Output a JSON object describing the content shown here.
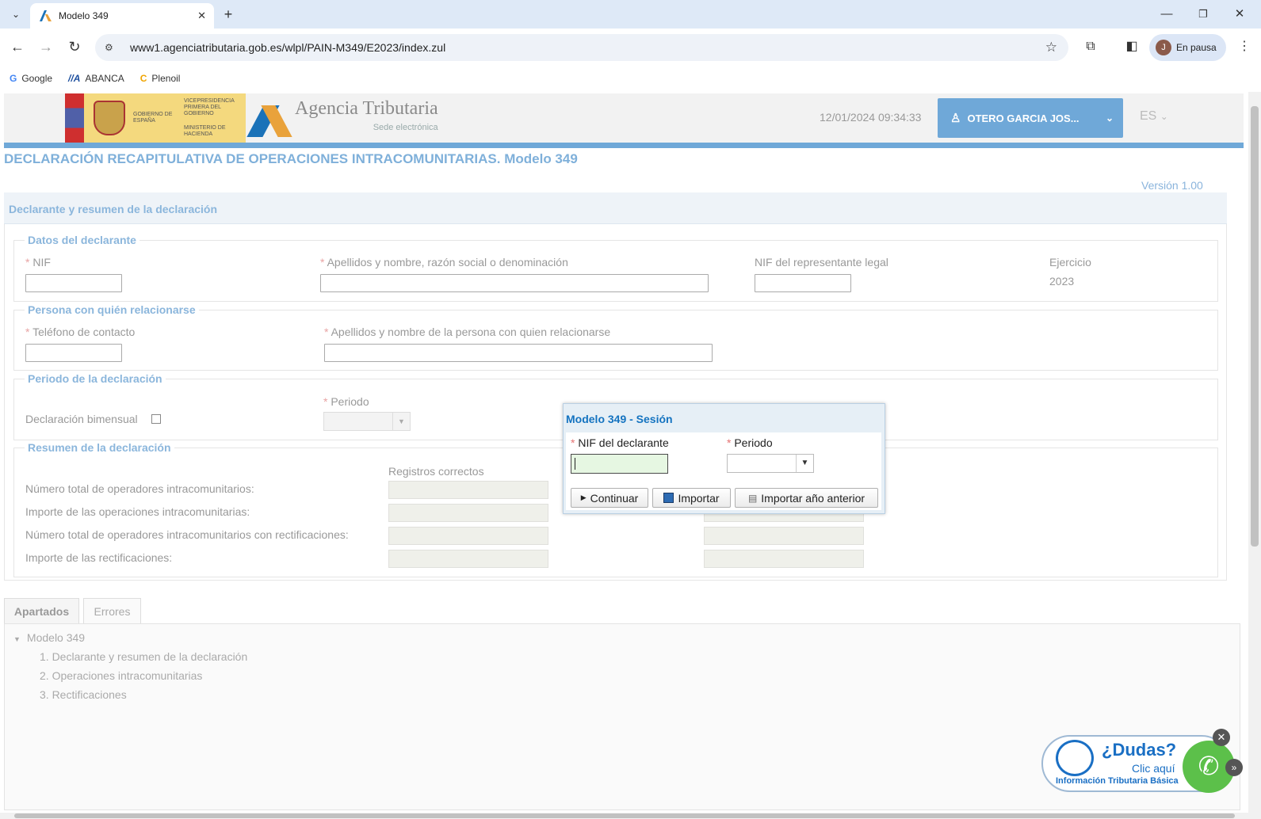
{
  "browser": {
    "tab_title": "Modelo 349",
    "new_tab": "+",
    "url": "www1.agenciatributaria.gob.es/wlpl/PAIN-M349/E2023/index.zul",
    "profile_initial": "J",
    "profile_label": "En pausa",
    "bookmarks": [
      {
        "label": "Google",
        "icon": "G"
      },
      {
        "label": "ABANCA",
        "icon": "//A"
      },
      {
        "label": "Plenoil",
        "icon": "C"
      }
    ]
  },
  "header": {
    "gov_line1": "GOBIERNO DE ESPAÑA",
    "gov_line2": "VICEPRESIDENCIA PRIMERA DEL GOBIERNO",
    "gov_line3": "MINISTERIO DE HACIENDA",
    "agency_name": "Agencia Tributaria",
    "agency_sub": "Sede electrónica",
    "datetime": "12/01/2024 09:34:33",
    "user": "OTERO GARCIA JOS...",
    "lang": "ES"
  },
  "page": {
    "title": "DECLARACIÓN RECAPITULATIVA DE OPERACIONES INTRACOMUNITARIAS. Modelo 349",
    "version": "Versión 1.00",
    "panel_title": "Declarante y resumen de la declaración"
  },
  "datos_declarante": {
    "legend": "Datos del declarante",
    "nif_label": "NIF",
    "apellidos_label": "Apellidos y nombre, razón social o denominación",
    "nif_rep_label": "NIF del representante legal",
    "ejercicio_label": "Ejercicio",
    "ejercicio_value": "2023"
  },
  "persona": {
    "legend": "Persona con quién relacionarse",
    "telefono_label": "Teléfono de contacto",
    "apellidos_label": "Apellidos y nombre de la persona con quien relacionarse"
  },
  "periodo": {
    "legend": "Periodo de la declaración",
    "bimensual_label": "Declaración bimensual",
    "periodo_label": "Periodo"
  },
  "resumen": {
    "legend": "Resumen de la declaración",
    "col_header": "Registros correctos",
    "rows": [
      "Número total de operadores intracomunitarios:",
      "Importe de las operaciones intracomunitarias:",
      "Número total de operadores intracomunitarios con rectificaciones:",
      "Importe de las rectificaciones:"
    ]
  },
  "dialog": {
    "title": "Modelo 349 - Sesión",
    "nif_label": "NIF del declarante",
    "periodo_label": "Periodo",
    "btn_continuar": "Continuar",
    "btn_importar": "Importar",
    "btn_importar_anterior": "Importar año anterior"
  },
  "tabs": {
    "apartados": "Apartados",
    "errores": "Errores"
  },
  "tree": {
    "root": "Modelo 349",
    "items": [
      "1. Declarante y resumen de la declaración",
      "2. Operaciones intracomunitarias",
      "3. Rectificaciones"
    ]
  },
  "dudas": {
    "title": "¿Dudas?",
    "click": "Clic aquí",
    "info": "Información Tributaria Básica"
  }
}
